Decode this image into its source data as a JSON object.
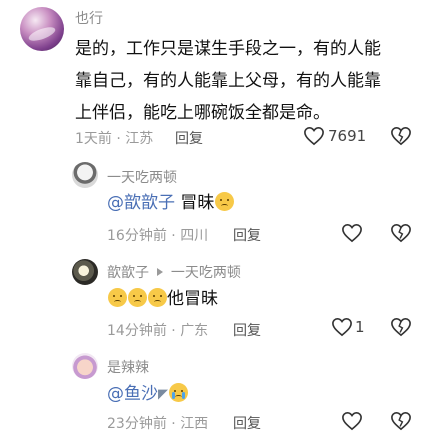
{
  "main_comment": {
    "username": "也行",
    "text": "是的，工作只是谋生手段之一，有的人能靠自己，有的人能靠上父母，有的人能靠上伴侣，能吃上哪碗饭全都是命。",
    "line1": "是的，工作只是谋生手段之一，有的人能",
    "line2": "靠自己，有的人能靠上父母，有的人能靠",
    "line3": "上伴侣，能吃上哪碗饭全都是命。",
    "time": "1天前",
    "location": "江苏",
    "reply_label": "回复",
    "like_count": "7691"
  },
  "replies": [
    {
      "username": "一天吃两顿",
      "mention": "@歆歆子",
      "text": "冒昧",
      "time": "16分钟前",
      "location": "四川",
      "reply_label": "回复",
      "like_count": ""
    },
    {
      "username": "歆歆子",
      "reply_to": "一天吃两顿",
      "text": "他冒昧",
      "time": "14分钟前",
      "location": "广东",
      "reply_label": "回复",
      "like_count": "1"
    },
    {
      "username": "是辣辣",
      "mention": "@鱼沙",
      "text": "",
      "time": "23分钟前",
      "location": "江西",
      "reply_label": "回复",
      "like_count": ""
    }
  ],
  "icons": {
    "like": "heart-outline-icon",
    "dislike": "broken-heart-outline-icon",
    "reply_arrow": "caret-right-icon"
  },
  "colors": {
    "mention": "#4a6fb5",
    "meta": "#9a9a9a",
    "icon": "#333333"
  }
}
